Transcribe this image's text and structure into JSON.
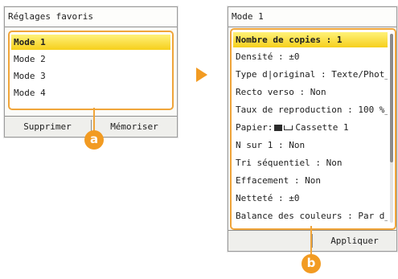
{
  "favorites_screen": {
    "title": "Réglages favoris",
    "modes": [
      "Mode 1",
      "Mode 2",
      "Mode 3",
      "Mode 4"
    ],
    "selected_index": 0,
    "delete_button": "Supprimer",
    "save_button": "Mémoriser"
  },
  "arrow_icon": "arrow-right-icon",
  "mode_screen": {
    "title": "Mode 1",
    "settings": [
      "Nombre de copies : 1",
      "Densité : ±0",
      "Type d|original : Texte/Phot_",
      "Recto verso : Non",
      "Taux de reproduction : 100 %_",
      "Papier:  Cassette 1",
      "N sur 1 : Non",
      "Tri séquentiel : Non",
      "Effacement : Non",
      "Netteté : ±0",
      "Balance des couleurs : Par d_"
    ],
    "selected_index": 0,
    "apply_button": "Appliquer"
  },
  "callouts": {
    "a": "a",
    "b": "b"
  },
  "colors": {
    "accent": "#f0a53a",
    "highlight": "#f6d21e",
    "badge": "#f29b22"
  }
}
